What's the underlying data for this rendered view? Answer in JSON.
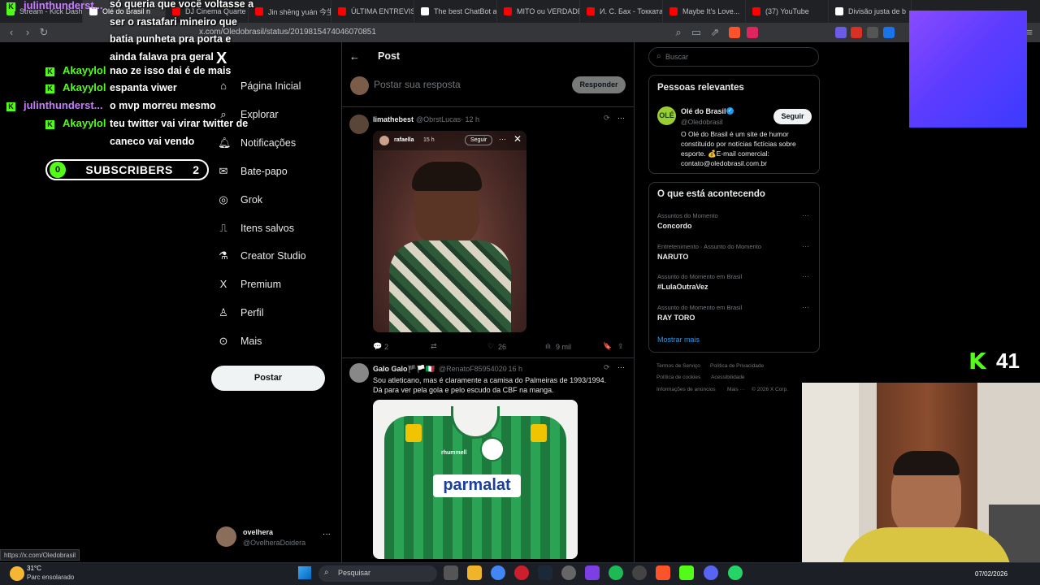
{
  "browser": {
    "tabs": [
      {
        "label": "Stream - Kick Dashb",
        "color": "#53fc18"
      },
      {
        "label": "Olé do Brasil n",
        "color": "#ffffff",
        "active": true
      },
      {
        "label": "DJ Cinema Quarte",
        "color": "#ff0000"
      },
      {
        "label": "Jin shēng yuán 今生",
        "color": "#ff0000"
      },
      {
        "label": "ÚLTIMA ENTREVIST",
        "color": "#ff0000"
      },
      {
        "label": "The best ChatBot a",
        "color": "#ffffff"
      },
      {
        "label": "MITO ou VERDADE",
        "color": "#ff0000"
      },
      {
        "label": "И. С. Бах - Токката",
        "color": "#ff0000"
      },
      {
        "label": "Maybe It's Love...",
        "color": "#ff0000"
      },
      {
        "label": "(37) YouTube",
        "color": "#ff0000"
      },
      {
        "label": "Divisão justa de b",
        "color": "#ffffff"
      }
    ],
    "url": "x.com/Oledobrasil/status/2019815474046070851",
    "status_url": "https://x.com/Oledobrasil"
  },
  "chat": {
    "users": [
      {
        "name": "julinthunderst...",
        "color": "#c77dff"
      },
      {
        "name": "Akayylol",
        "color": "#53fc18"
      },
      {
        "name": "Akayylol",
        "color": "#53fc18"
      },
      {
        "name": "julinthunderst...",
        "color": "#c77dff"
      },
      {
        "name": "Akayylol",
        "color": "#53fc18"
      }
    ],
    "messages": [
      "só queria que você voltasse a ser o rastafari mineiro que batia punheta pra porta e ainda falava pra geral",
      "nao ze isso dai é de mais",
      "espanta viwer",
      "o mvp morreu mesmo",
      "teu twitter vai virar twitter de caneco vai vendo"
    ],
    "subscribers": {
      "label": "SUBSCRIBERS",
      "left_count": "0",
      "right_count": "2"
    }
  },
  "x_nav": {
    "logo": "X",
    "items": [
      {
        "label": "Página Inicial",
        "icon": "home-icon"
      },
      {
        "label": "Explorar",
        "icon": "search-icon"
      },
      {
        "label": "Notificações",
        "icon": "bell-icon"
      },
      {
        "label": "Bate-papo",
        "icon": "mail-icon"
      },
      {
        "label": "Grok",
        "icon": "grok-icon"
      },
      {
        "label": "Itens salvos",
        "icon": "bookmark-icon"
      },
      {
        "label": "Creator Studio",
        "icon": "flask-icon"
      },
      {
        "label": "Premium",
        "icon": "x-icon"
      },
      {
        "label": "Perfil",
        "icon": "person-icon"
      },
      {
        "label": "Mais",
        "icon": "more-circle-icon"
      }
    ],
    "post_button": "Postar",
    "account": {
      "name": "ovelhera",
      "handle": "@OvelheraDoidera"
    }
  },
  "post_view": {
    "title": "Post",
    "reply_placeholder": "Postar sua resposta",
    "reply_button": "Responder",
    "tweets": [
      {
        "name": "limathebest",
        "handle": "@ObrstLucas",
        "time": "· 12 h",
        "embedded": {
          "user": "rafaella",
          "time": "15 h",
          "follow": "Seguir"
        },
        "replies": "2",
        "likes": "26",
        "views": "9 mil"
      },
      {
        "name": "Galo Galo🏴🏳️🇮🇹",
        "handle": "@RenatoF85954020",
        "time": "· 16 h",
        "text": "Sou atleticano, mas é claramente a camisa do Palmeiras de 1993/1994. Dá para ver pela gola e pelo escudo da CBF na manga.",
        "jersey_sponsor": "parmalat",
        "jersey_brand": "rhummell"
      }
    ]
  },
  "sidebar": {
    "search_placeholder": "Buscar",
    "relevant_title": "Pessoas relevantes",
    "relevant_person": {
      "name": "Olé do Brasil",
      "handle": "@Oledobrasil",
      "follow": "Seguir",
      "bio": "O Olé do Brasil é um site de humor constituído por notícias fictícias sobre esporte. 💰E-mail comercial: contato@oledobrasil.com.br"
    },
    "trends_title": "O que está acontecendo",
    "trends": [
      {
        "meta": "Assuntos do Momento",
        "name": "Concordo"
      },
      {
        "meta": "Entretenimento · Assunto do Momento",
        "name": "NARUTO"
      },
      {
        "meta": "Assunto do Momento em Brasil",
        "name": "#LulaOutraVez"
      },
      {
        "meta": "Assunto do Momento em Brasil",
        "name": "RAY TORO"
      }
    ],
    "show_more": "Mostrar mais",
    "footer": [
      "Termos de Serviço",
      "Política de Privacidade",
      "Política de cookies",
      "Acessibilidade",
      "Informações de anúncios",
      "Mais ···",
      "© 2026 X Corp."
    ]
  },
  "overlay": {
    "kick_viewers": "41",
    "kick_logo": "K"
  },
  "taskbar": {
    "weather_temp": "31°C",
    "weather_desc": "Parc ensolarado",
    "search_placeholder": "Pesquisar",
    "date": "07/02/2026"
  }
}
